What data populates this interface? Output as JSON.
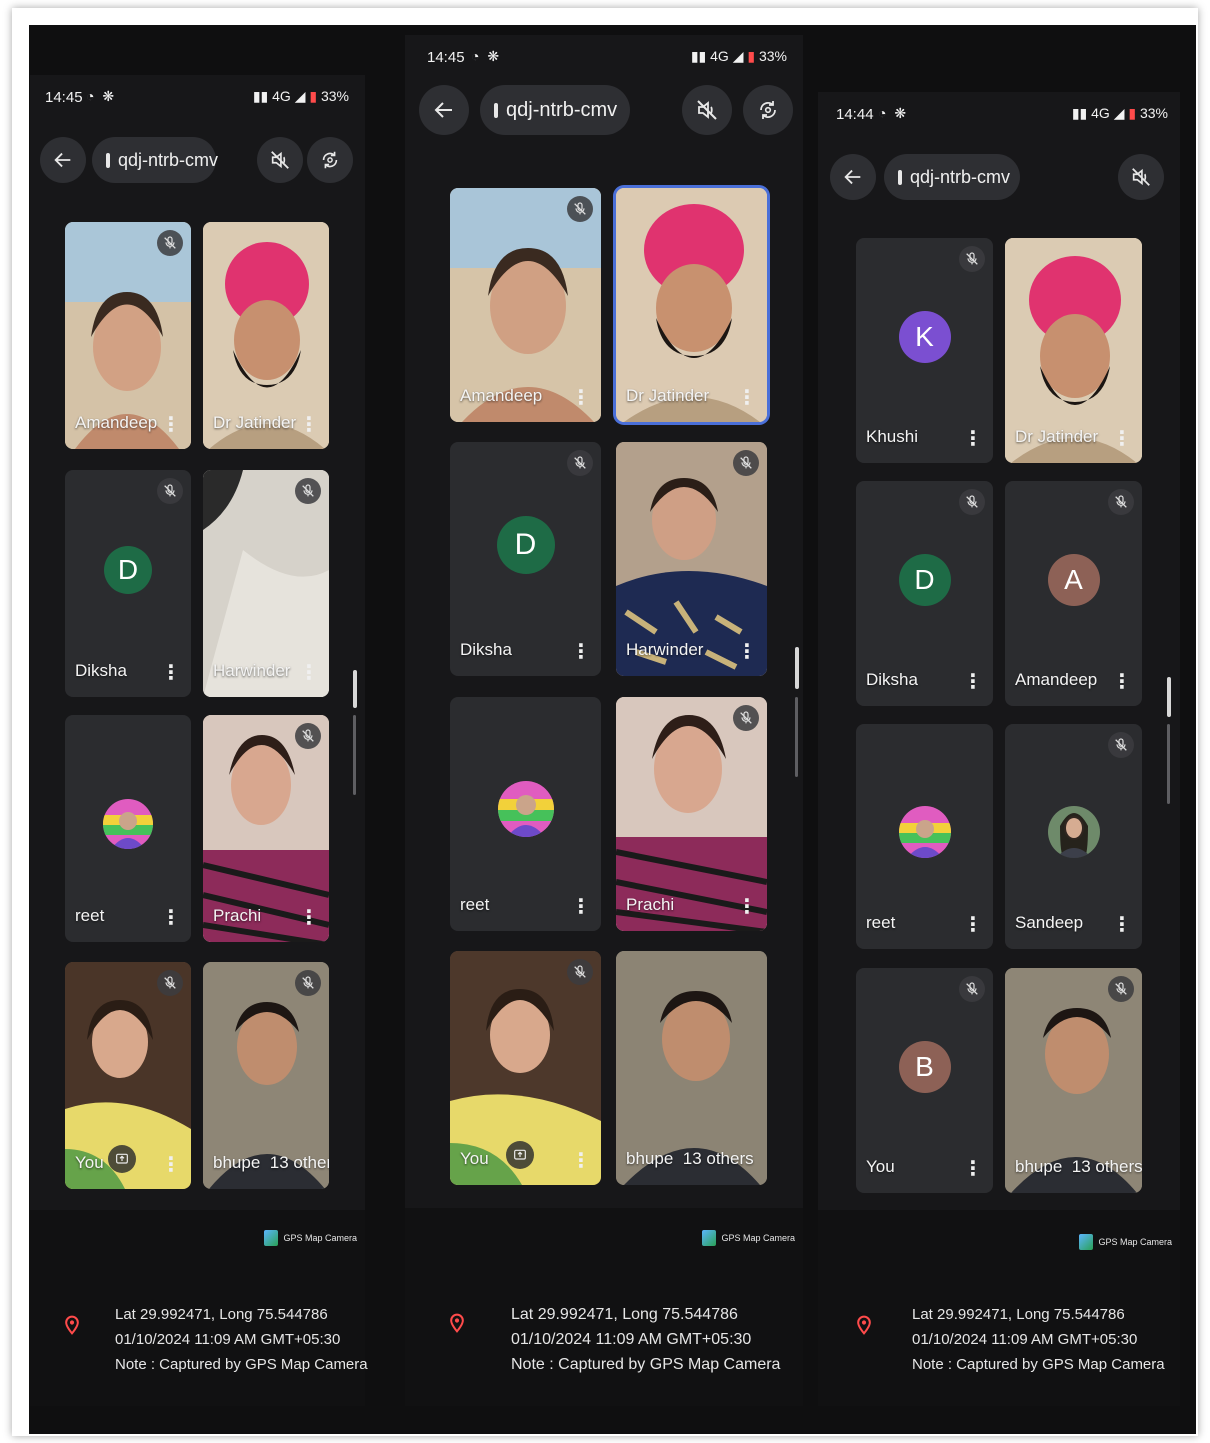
{
  "panels": [
    {
      "status_time": "14:45",
      "status_right": "4G",
      "battery": "33%",
      "meeting_code": "qdj-ntrb-cmv",
      "tiles": [
        {
          "name": "Amandeep"
        },
        {
          "name": "Dr Jatinder"
        },
        {
          "name": "Diksha",
          "initial": "D"
        },
        {
          "name": "Harwinder"
        },
        {
          "name": "reet"
        },
        {
          "name": "Prachi"
        },
        {
          "name": "You"
        },
        {
          "name": "bhupe",
          "others": "13 others"
        }
      ],
      "gps": {
        "brand": "GPS Map Camera",
        "coords": "Lat 29.992471, Long 75.544786",
        "datetime": "01/10/2024 11:09 AM GMT+05:30",
        "note": "Note : Captured by GPS Map Camera"
      }
    },
    {
      "status_time": "14:45",
      "status_right": "4G",
      "battery": "33%",
      "meeting_code": "qdj-ntrb-cmv",
      "tiles": [
        {
          "name": "Amandeep"
        },
        {
          "name": "Dr Jatinder"
        },
        {
          "name": "Diksha",
          "initial": "D"
        },
        {
          "name": "Harwinder"
        },
        {
          "name": "reet"
        },
        {
          "name": "Prachi"
        },
        {
          "name": "You"
        },
        {
          "name": "bhupe",
          "others": "13 others"
        }
      ],
      "gps": {
        "brand": "GPS Map Camera",
        "coords": "Lat 29.992471, Long 75.544786",
        "datetime": "01/10/2024 11:09 AM GMT+05:30",
        "note": "Note : Captured by GPS Map Camera"
      }
    },
    {
      "status_time": "14:44",
      "status_right": "4G",
      "battery": "33%",
      "meeting_code": "qdj-ntrb-cmv",
      "tiles": [
        {
          "name": "Khushi",
          "initial": "K"
        },
        {
          "name": "Dr Jatinder"
        },
        {
          "name": "Diksha",
          "initial": "D"
        },
        {
          "name": "Amandeep",
          "initial": "A"
        },
        {
          "name": "reet"
        },
        {
          "name": "Sandeep"
        },
        {
          "name": "You",
          "initial": "B"
        },
        {
          "name": "bhupe",
          "others": "13 others"
        }
      ],
      "gps": {
        "brand": "GPS Map Camera",
        "coords": "Lat 29.992471, Long 75.544786",
        "datetime": "01/10/2024 11:09 AM GMT+05:30",
        "note": "Note : Captured by GPS Map Camera"
      }
    }
  ],
  "colors": {
    "avatar_khushi": "#7b4fd1",
    "avatar_diksha": "#1e6b46",
    "avatar_amandeep": "#8d6156",
    "avatar_b": "#8d6156",
    "highlight": "#4a6fd8",
    "pin": "#ff4b4b"
  },
  "icons": [
    "back-arrow-icon",
    "calendar-icon",
    "speaker-off-icon",
    "camera-switch-icon",
    "mic-off-icon",
    "more-vert-icon",
    "present-icon",
    "location-pin-icon"
  ]
}
